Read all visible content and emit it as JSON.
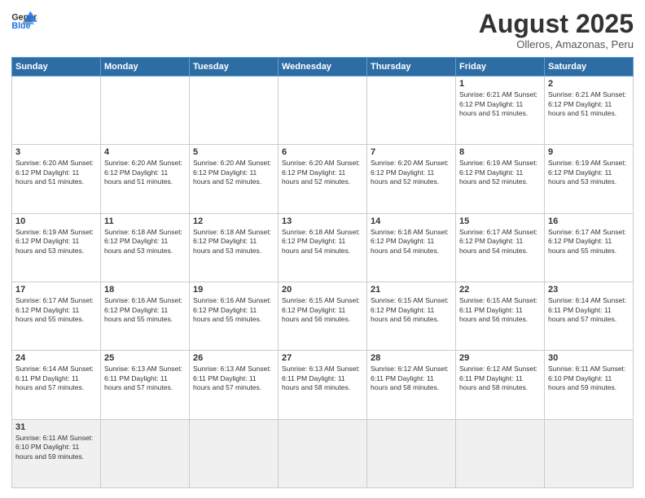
{
  "header": {
    "logo_general": "General",
    "logo_blue": "Blue",
    "month_title": "August 2025",
    "subtitle": "Olleros, Amazonas, Peru"
  },
  "days_of_week": [
    "Sunday",
    "Monday",
    "Tuesday",
    "Wednesday",
    "Thursday",
    "Friday",
    "Saturday"
  ],
  "weeks": [
    [
      {
        "day": "",
        "info": ""
      },
      {
        "day": "",
        "info": ""
      },
      {
        "day": "",
        "info": ""
      },
      {
        "day": "",
        "info": ""
      },
      {
        "day": "",
        "info": ""
      },
      {
        "day": "1",
        "info": "Sunrise: 6:21 AM\nSunset: 6:12 PM\nDaylight: 11 hours and 51 minutes."
      },
      {
        "day": "2",
        "info": "Sunrise: 6:21 AM\nSunset: 6:12 PM\nDaylight: 11 hours and 51 minutes."
      }
    ],
    [
      {
        "day": "3",
        "info": "Sunrise: 6:20 AM\nSunset: 6:12 PM\nDaylight: 11 hours and 51 minutes."
      },
      {
        "day": "4",
        "info": "Sunrise: 6:20 AM\nSunset: 6:12 PM\nDaylight: 11 hours and 51 minutes."
      },
      {
        "day": "5",
        "info": "Sunrise: 6:20 AM\nSunset: 6:12 PM\nDaylight: 11 hours and 52 minutes."
      },
      {
        "day": "6",
        "info": "Sunrise: 6:20 AM\nSunset: 6:12 PM\nDaylight: 11 hours and 52 minutes."
      },
      {
        "day": "7",
        "info": "Sunrise: 6:20 AM\nSunset: 6:12 PM\nDaylight: 11 hours and 52 minutes."
      },
      {
        "day": "8",
        "info": "Sunrise: 6:19 AM\nSunset: 6:12 PM\nDaylight: 11 hours and 52 minutes."
      },
      {
        "day": "9",
        "info": "Sunrise: 6:19 AM\nSunset: 6:12 PM\nDaylight: 11 hours and 53 minutes."
      }
    ],
    [
      {
        "day": "10",
        "info": "Sunrise: 6:19 AM\nSunset: 6:12 PM\nDaylight: 11 hours and 53 minutes."
      },
      {
        "day": "11",
        "info": "Sunrise: 6:18 AM\nSunset: 6:12 PM\nDaylight: 11 hours and 53 minutes."
      },
      {
        "day": "12",
        "info": "Sunrise: 6:18 AM\nSunset: 6:12 PM\nDaylight: 11 hours and 53 minutes."
      },
      {
        "day": "13",
        "info": "Sunrise: 6:18 AM\nSunset: 6:12 PM\nDaylight: 11 hours and 54 minutes."
      },
      {
        "day": "14",
        "info": "Sunrise: 6:18 AM\nSunset: 6:12 PM\nDaylight: 11 hours and 54 minutes."
      },
      {
        "day": "15",
        "info": "Sunrise: 6:17 AM\nSunset: 6:12 PM\nDaylight: 11 hours and 54 minutes."
      },
      {
        "day": "16",
        "info": "Sunrise: 6:17 AM\nSunset: 6:12 PM\nDaylight: 11 hours and 55 minutes."
      }
    ],
    [
      {
        "day": "17",
        "info": "Sunrise: 6:17 AM\nSunset: 6:12 PM\nDaylight: 11 hours and 55 minutes."
      },
      {
        "day": "18",
        "info": "Sunrise: 6:16 AM\nSunset: 6:12 PM\nDaylight: 11 hours and 55 minutes."
      },
      {
        "day": "19",
        "info": "Sunrise: 6:16 AM\nSunset: 6:12 PM\nDaylight: 11 hours and 55 minutes."
      },
      {
        "day": "20",
        "info": "Sunrise: 6:15 AM\nSunset: 6:12 PM\nDaylight: 11 hours and 56 minutes."
      },
      {
        "day": "21",
        "info": "Sunrise: 6:15 AM\nSunset: 6:12 PM\nDaylight: 11 hours and 56 minutes."
      },
      {
        "day": "22",
        "info": "Sunrise: 6:15 AM\nSunset: 6:11 PM\nDaylight: 11 hours and 56 minutes."
      },
      {
        "day": "23",
        "info": "Sunrise: 6:14 AM\nSunset: 6:11 PM\nDaylight: 11 hours and 57 minutes."
      }
    ],
    [
      {
        "day": "24",
        "info": "Sunrise: 6:14 AM\nSunset: 6:11 PM\nDaylight: 11 hours and 57 minutes."
      },
      {
        "day": "25",
        "info": "Sunrise: 6:13 AM\nSunset: 6:11 PM\nDaylight: 11 hours and 57 minutes."
      },
      {
        "day": "26",
        "info": "Sunrise: 6:13 AM\nSunset: 6:11 PM\nDaylight: 11 hours and 57 minutes."
      },
      {
        "day": "27",
        "info": "Sunrise: 6:13 AM\nSunset: 6:11 PM\nDaylight: 11 hours and 58 minutes."
      },
      {
        "day": "28",
        "info": "Sunrise: 6:12 AM\nSunset: 6:11 PM\nDaylight: 11 hours and 58 minutes."
      },
      {
        "day": "29",
        "info": "Sunrise: 6:12 AM\nSunset: 6:11 PM\nDaylight: 11 hours and 58 minutes."
      },
      {
        "day": "30",
        "info": "Sunrise: 6:11 AM\nSunset: 6:10 PM\nDaylight: 11 hours and 59 minutes."
      }
    ],
    [
      {
        "day": "31",
        "info": "Sunrise: 6:11 AM\nSunset: 6:10 PM\nDaylight: 11 hours and 59 minutes."
      },
      {
        "day": "",
        "info": ""
      },
      {
        "day": "",
        "info": ""
      },
      {
        "day": "",
        "info": ""
      },
      {
        "day": "",
        "info": ""
      },
      {
        "day": "",
        "info": ""
      },
      {
        "day": "",
        "info": ""
      }
    ]
  ]
}
